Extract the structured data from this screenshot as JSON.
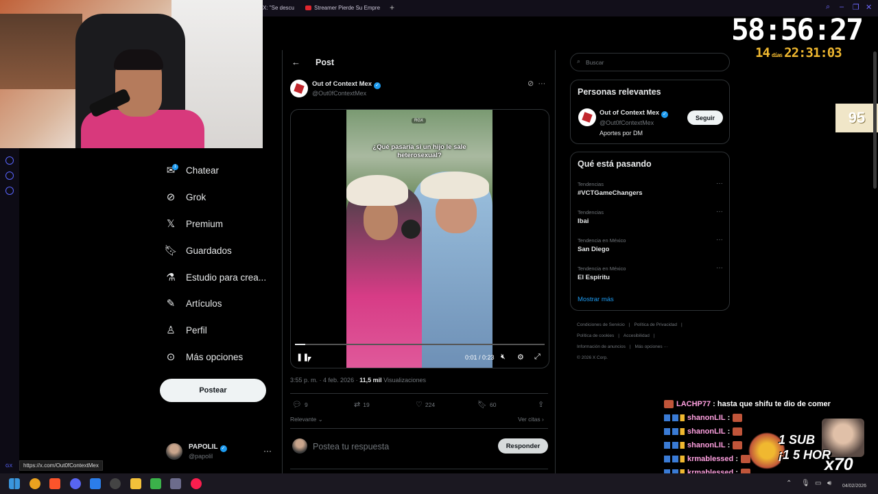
{
  "browser": {
    "tabs": [
      {
        "label": "X: \"Se descu"
      },
      {
        "label": "Streamer Pierde Su Empre"
      }
    ],
    "new_tab": "+",
    "gx_label": "GX",
    "status_url": "https://x.com/Out0fContextMex"
  },
  "nav": {
    "items": [
      {
        "label": "Chatear",
        "icon": "mail-icon",
        "badge": "1"
      },
      {
        "label": "Grok",
        "icon": "grok-icon"
      },
      {
        "label": "Premium",
        "icon": "x-icon"
      },
      {
        "label": "Guardados",
        "icon": "bookmark-icon"
      },
      {
        "label": "Estudio para crea...",
        "icon": "flask-icon"
      },
      {
        "label": "Artículos",
        "icon": "article-icon"
      },
      {
        "label": "Perfil",
        "icon": "person-icon"
      },
      {
        "label": "Más opciones",
        "icon": "more-circle-icon"
      }
    ],
    "post_button": "Postear",
    "account": {
      "name": "PAPOLIL",
      "handle": "@papolil",
      "more": "···"
    }
  },
  "post": {
    "header_title": "Post",
    "author": {
      "name": "Out of Context Mex",
      "handle": "@Out0fContextMex"
    },
    "video": {
      "caption": "¿Qué pasaría si un hijo le sale heterosexual?",
      "tag": "RGX",
      "current_time": "0:01",
      "duration": "0:23",
      "progress": 0.04
    },
    "time": "3:55 p. m.",
    "date": "4 feb. 2026",
    "views_count": "11,5 mil",
    "views_label": "Visualizaciones",
    "stats": {
      "replies": "9",
      "reposts": "19",
      "likes": "224",
      "bookmarks": "60"
    },
    "sort_label": "Relevante",
    "quotes_label": "Ver citas",
    "reply_placeholder": "Postea tu respuesta",
    "reply_button": "Responder"
  },
  "sidebar": {
    "search_placeholder": "Buscar",
    "relevant": {
      "title": "Personas relevantes",
      "name": "Out of Context Mex",
      "handle": "@Out0fContextMex",
      "bio": "Aportes por DM",
      "follow_button": "Seguir"
    },
    "trending": {
      "title": "Qué está pasando",
      "items": [
        {
          "category": "Tendencias",
          "name": "#VCTGameChangers"
        },
        {
          "category": "Tendencias",
          "name": "Ibai"
        },
        {
          "category": "Tendencia en México",
          "name": "San Diego"
        },
        {
          "category": "Tendencia en México",
          "name": "El Espíritu"
        }
      ],
      "show_more": "Mostrar más"
    },
    "footer": {
      "links": [
        "Condiciones de Servicio",
        "|",
        "Política de Privacidad",
        "|",
        "Política de cookies",
        "|",
        "Accesibilidad",
        "|",
        "Información de anuncios",
        "|",
        "Más opciones ···"
      ],
      "copyright": "© 2026 X Corp."
    }
  },
  "overlay": {
    "timer": "58:56:27",
    "sub_days": "14",
    "sub_days_label": "días",
    "sub_time": "22:31:03",
    "score": "95",
    "chat": [
      {
        "user": "LACHP77",
        "message": "hasta que shifu te dio de comer"
      },
      {
        "user": "shanonLIL",
        "message": ""
      },
      {
        "user": "shanonLIL",
        "message": ""
      },
      {
        "user": "shanonLIL",
        "message": ""
      },
      {
        "user": "krmablessed",
        "message": ""
      },
      {
        "user": "krmablessed",
        "message": ""
      },
      {
        "user": "krmablessed",
        "message": ""
      }
    ],
    "promo_text_1": "1 SUB",
    "promo_text_2": "¡1 5 HOR",
    "promo_mult": "x70"
  },
  "taskbar": {
    "date": "04/02/2026"
  },
  "colors": {
    "accent": "#1d9bf0",
    "timer_sub": "#f0b830",
    "chat_user": "#ffa0e0"
  }
}
